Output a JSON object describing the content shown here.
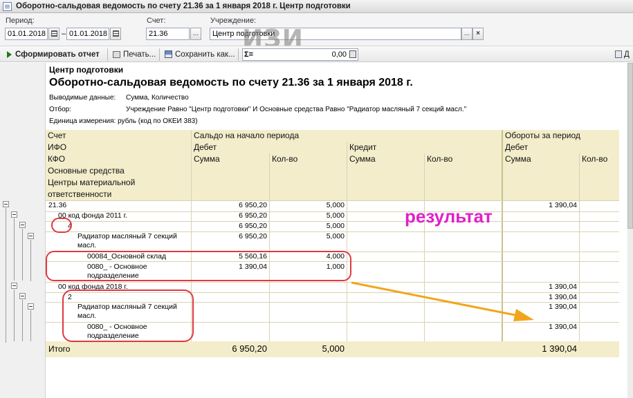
{
  "window": {
    "title": "Оборотно-сальдовая ведомость по счету 21.36 за 1 января 2018 г. Центр подготовки"
  },
  "filters": {
    "period_label": "Период:",
    "period_from": "01.01.2018",
    "period_to": "01.01.2018",
    "account_label": "Счет:",
    "account_value": "21.36",
    "institution_label": "Учреждение:",
    "institution_value": "Центр подготовки",
    "ellipsis": "...",
    "clear": "×"
  },
  "toolbar": {
    "run": "Сформировать отчет",
    "print": "Печать...",
    "save": "Сохранить как...",
    "sum_symbol": "Σ=",
    "sum_value": "0,00",
    "right_item": "Д"
  },
  "watermark": "ИЗИ",
  "report": {
    "org": "Центр подготовки",
    "title": "Оборотно-сальдовая ведомость по счету 21.36 за 1 января 2018 г.",
    "shown_label": "Выводимые данные:",
    "shown_value": "Сумма, Количество",
    "filter_label": "Отбор:",
    "filter_value": "Учреждение Равно \"Центр подготовки\" И Основные средства Равно \"Радиатор масляный 7 секций масл.\"",
    "unit": "Единица измерения: рубль (код по ОКЕИ 383)"
  },
  "table": {
    "h_account": "Счет",
    "h_ifo": "ИФО",
    "h_kfo": "КФО",
    "h_os": "Основные средства",
    "h_cmo": "Центры материальной ответственности",
    "h_opening": "Сальдо на начало периода",
    "h_debit": "Дебет",
    "h_credit": "Кредит",
    "h_turnover": "Обороты за период",
    "h_turn_debit": "Дебет",
    "h_sum1": "Сумма",
    "h_qty1": "Кол-во",
    "h_sum2": "Сумма",
    "h_qty2": "Кол-во",
    "h_sum3": "Сумма",
    "h_qty3": "Кол-во",
    "rows": [
      {
        "name": "21.36",
        "d_sum": "6 950,20",
        "d_qty": "5,000",
        "t_sum": "1 390,04"
      },
      {
        "name": "00 код фонда 2011 г.",
        "d_sum": "6 950,20",
        "d_qty": "5,000",
        "t_sum": ""
      },
      {
        "name": "4",
        "d_sum": "6 950,20",
        "d_qty": "5,000",
        "t_sum": ""
      },
      {
        "name": "Радиатор масляный 7 секций масл.",
        "d_sum": "6 950,20",
        "d_qty": "5,000",
        "t_sum": ""
      },
      {
        "name": "00084_Основной склад",
        "d_sum": "5 560,16",
        "d_qty": "4,000",
        "t_sum": ""
      },
      {
        "name": "0080_ - Основное подразделение",
        "d_sum": "1 390,04",
        "d_qty": "1,000",
        "t_sum": ""
      },
      {
        "name": "00 код фонда 2018 г.",
        "d_sum": "",
        "d_qty": "",
        "t_sum": "1 390,04"
      },
      {
        "name": "2",
        "d_sum": "",
        "d_qty": "",
        "t_sum": "1 390,04"
      },
      {
        "name": "Радиатор масляный 7 секций масл.",
        "d_sum": "",
        "d_qty": "",
        "t_sum": "1 390,04"
      },
      {
        "name": "0080_ - Основное подразделение",
        "d_sum": "",
        "d_qty": "",
        "t_sum": "1 390,04"
      }
    ],
    "total_label": "Итого",
    "total_d_sum": "6 950,20",
    "total_d_qty": "5,000",
    "total_t_sum": "1 390,04"
  },
  "annotation": {
    "text": "результат",
    "oval_color": "#e0383f",
    "arrow_color": "#f2a51c",
    "text_color": "#e020c8"
  }
}
